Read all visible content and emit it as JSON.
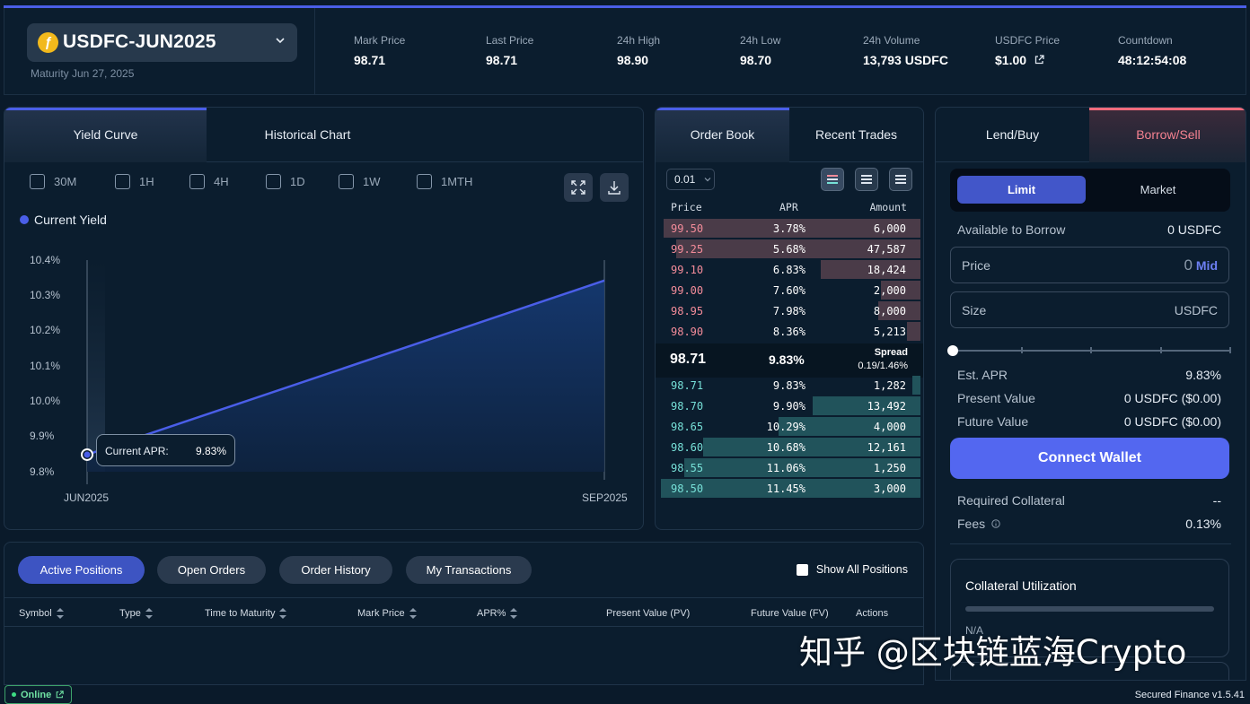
{
  "header": {
    "asset": "USDFC-JUN2025",
    "coin_symbol": "ƒ",
    "maturity": "Maturity Jun 27, 2025",
    "stats": [
      {
        "label": "Mark Price",
        "value": "98.71"
      },
      {
        "label": "Last Price",
        "value": "98.71"
      },
      {
        "label": "24h High",
        "value": "98.90"
      },
      {
        "label": "24h Low",
        "value": "98.70"
      },
      {
        "label": "24h Volume",
        "value": "13,793 USDFC"
      },
      {
        "label": "USDFC Price",
        "value": "$1.00"
      },
      {
        "label": "Countdown",
        "value": "48:12:54:08"
      }
    ]
  },
  "chart_panel": {
    "tabs": [
      "Yield Curve",
      "Historical Chart"
    ],
    "timeframes": [
      "30M",
      "1H",
      "4H",
      "1D",
      "1W",
      "1MTH"
    ],
    "legend": "Current Yield",
    "tooltip_label": "Current APR:",
    "tooltip_value": "9.83%"
  },
  "chart_data": {
    "type": "area",
    "series": [
      {
        "name": "Current Yield",
        "x": [
          "JUN2025",
          "SEP2025"
        ],
        "values": [
          9.83,
          10.34
        ]
      }
    ],
    "xlabels": [
      "JUN2025",
      "SEP2025"
    ],
    "yticks": [
      "10.4%",
      "10.3%",
      "10.2%",
      "10.1%",
      "10.0%",
      "9.9%",
      "9.8%"
    ],
    "ylim": [
      9.78,
      10.4
    ],
    "color": "#4a5ee8"
  },
  "order_book": {
    "tabs": [
      "Order Book",
      "Recent Trades"
    ],
    "tick": "0.01",
    "columns": [
      "Price",
      "APR",
      "Amount"
    ],
    "asks": [
      {
        "price": "99.50",
        "apr": "3.78%",
        "amount": "6,000",
        "depth": 0.98
      },
      {
        "price": "99.25",
        "apr": "5.68%",
        "amount": "47,587",
        "depth": 0.93
      },
      {
        "price": "99.10",
        "apr": "6.83%",
        "amount": "18,424",
        "depth": 0.38
      },
      {
        "price": "99.00",
        "apr": "7.60%",
        "amount": "2,000",
        "depth": 0.15
      },
      {
        "price": "98.95",
        "apr": "7.98%",
        "amount": "8,000",
        "depth": 0.16
      },
      {
        "price": "98.90",
        "apr": "8.36%",
        "amount": "5,213",
        "depth": 0.05
      }
    ],
    "mid_price": "98.71",
    "mid_apr": "9.83%",
    "spread_label": "Spread",
    "spread_value": "0.19/1.46%",
    "bids": [
      {
        "price": "98.71",
        "apr": "9.83%",
        "amount": "1,282",
        "depth": 0.03
      },
      {
        "price": "98.70",
        "apr": "9.90%",
        "amount": "13,492",
        "depth": 0.41
      },
      {
        "price": "98.65",
        "apr": "10.29%",
        "amount": "4,000",
        "depth": 0.54
      },
      {
        "price": "98.60",
        "apr": "10.68%",
        "amount": "12,161",
        "depth": 0.83
      },
      {
        "price": "98.55",
        "apr": "11.06%",
        "amount": "1,250",
        "depth": 0.9
      },
      {
        "price": "98.50",
        "apr": "11.45%",
        "amount": "3,000",
        "depth": 0.99
      }
    ]
  },
  "trade": {
    "tabs": [
      "Lend/Buy",
      "Borrow/Sell"
    ],
    "order_types": [
      "Limit",
      "Market"
    ],
    "available_label": "Available to Borrow",
    "available_value": "0 USDFC",
    "price_label": "Price",
    "price_value": "0",
    "mid_label": "Mid",
    "size_label": "Size",
    "size_unit": "USDFC",
    "est_apr_label": "Est. APR",
    "est_apr_value": "9.83%",
    "pv_label": "Present Value",
    "pv_value": "0 USDFC ($0.00)",
    "fv_label": "Future Value",
    "fv_value": "0 USDFC ($0.00)",
    "connect_label": "Connect Wallet",
    "collateral_label": "Required Collateral",
    "collateral_value": "--",
    "fees_label": "Fees",
    "fees_value": "0.13%",
    "utilization_label": "Collateral Utilization",
    "utilization_value": "N/A"
  },
  "positions": {
    "tabs": [
      "Active Positions",
      "Open Orders",
      "Order History",
      "My Transactions"
    ],
    "show_all": "Show All Positions",
    "columns": [
      "Symbol",
      "Type",
      "Time to Maturity",
      "Mark Price",
      "APR%",
      "Present Value (PV)",
      "Future Value (FV)",
      "Actions"
    ]
  },
  "footer": {
    "status": "Online",
    "version": "Secured Finance v1.5.41",
    "watermark": "知乎 @区块链蓝海Crypto"
  }
}
